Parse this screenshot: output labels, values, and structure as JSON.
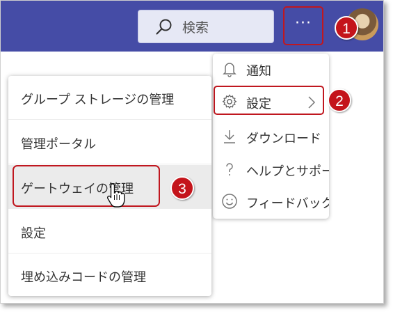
{
  "header": {
    "search_label": "検索",
    "more_label": "···",
    "search_icon": "search-icon",
    "colors": {
      "bar": "#454ca6",
      "accent_red": "#c4141b"
    }
  },
  "callouts": [
    "1",
    "2",
    "3"
  ],
  "settings_menu": {
    "items": [
      {
        "label": "通知",
        "icon": "bell-icon"
      },
      {
        "label": "設定",
        "icon": "gear-icon"
      },
      {
        "label": "ダウンロード",
        "icon": "download-icon"
      },
      {
        "label": "ヘルプとサポート",
        "icon": "help-icon"
      },
      {
        "label": "フィードバック",
        "icon": "smiley-icon"
      }
    ]
  },
  "submenu": {
    "items": [
      {
        "label": "グループ ストレージの管理"
      },
      {
        "label": "管理ポータル"
      },
      {
        "label": "ゲートウェイの管理"
      },
      {
        "label": "設定"
      },
      {
        "label": "埋め込みコードの管理"
      }
    ]
  }
}
